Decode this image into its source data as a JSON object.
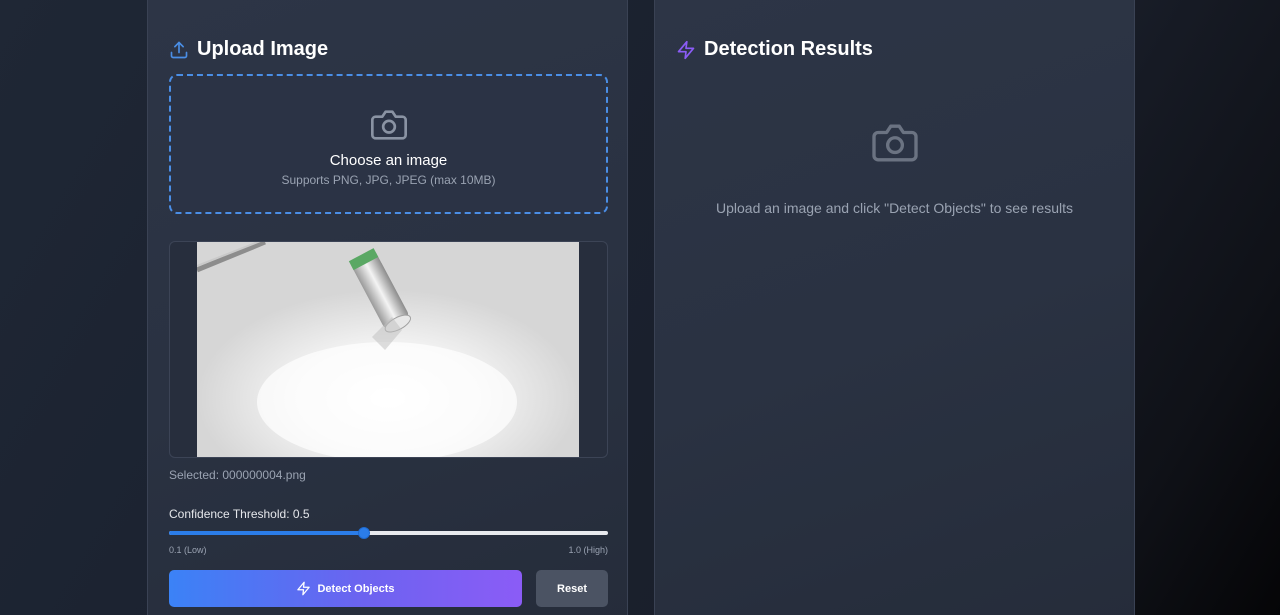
{
  "upload_panel": {
    "title": "Upload Image",
    "dropzone_title": "Choose an image",
    "dropzone_subtitle": "Supports PNG, JPG, JPEG (max 10MB)",
    "selected_prefix": "Selected: ",
    "selected_file": "000000004.png",
    "threshold_label": "Confidence Threshold: ",
    "threshold_value": "0.5",
    "threshold_min": 0.1,
    "threshold_max": 1.0,
    "range_low_label": "0.1 (Low)",
    "range_high_label": "1.0 (High)",
    "detect_label": "Detect Objects",
    "reset_label": "Reset"
  },
  "results_panel": {
    "title": "Detection Results",
    "empty_hint": "Upload an image and click \"Detect Objects\" to see results"
  },
  "colors": {
    "accent_blue": "#3b82f6",
    "accent_purple": "#8b5cf6",
    "dropzone_border": "#4a8ee6"
  },
  "icons": {
    "upload": "upload-icon",
    "camera": "camera-icon",
    "lightning": "lightning-icon"
  }
}
